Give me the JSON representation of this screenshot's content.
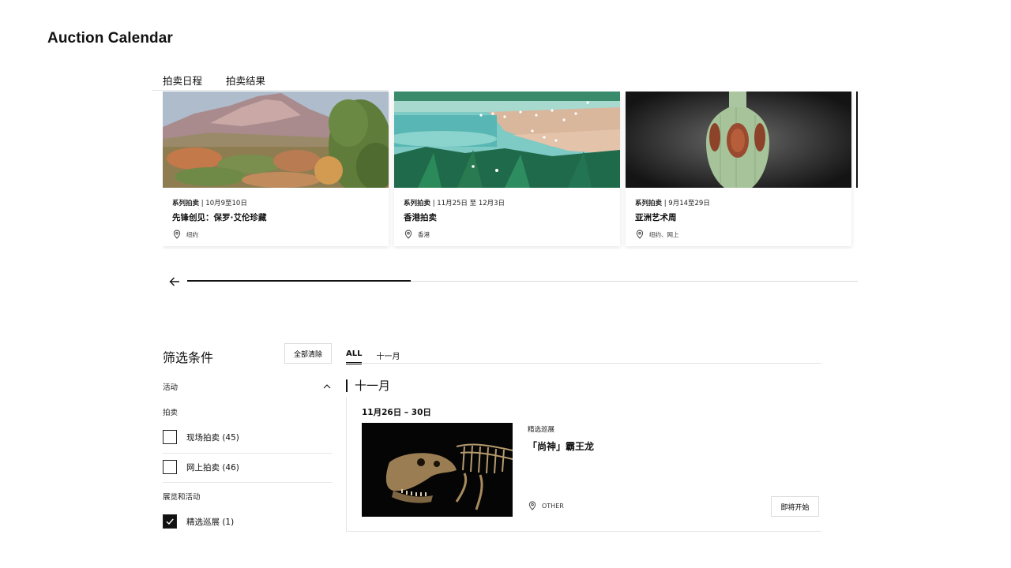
{
  "page": {
    "title": "Auction Calendar"
  },
  "tabs": [
    {
      "label": "拍卖日程",
      "active": true
    },
    {
      "label": "拍卖结果",
      "active": false
    }
  ],
  "carousel": {
    "cards": [
      {
        "meta_type": "系列拍卖",
        "meta_dates": " | 10月9至10日",
        "title": "先锋创见：保罗·艾伦珍藏",
        "location": "纽约",
        "image": "mountain-landscape-painting"
      },
      {
        "meta_type": "系列拍卖",
        "meta_dates": " | 11月25日 至 12月3日",
        "title": "香港拍卖",
        "location": "香港",
        "image": "lake-with-birds-painting"
      },
      {
        "meta_type": "系列拍卖",
        "meta_dates": " | 9月14至29日",
        "title": "亚洲艺术周",
        "location": "纽约、网上",
        "image": "celadon-vase-photo"
      }
    ],
    "progress_fraction": 0.333
  },
  "filters": {
    "title": "筛选条件",
    "clear_label": "全部清除",
    "section_label": "活动",
    "auction_group_label": "拍卖",
    "auction_options": [
      {
        "label": "现场拍卖 (45)",
        "checked": false
      },
      {
        "label": "网上拍卖 (46)",
        "checked": false
      }
    ],
    "exhibit_group_label": "展览和活动",
    "exhibit_options": [
      {
        "label": "精选巡展 (1)",
        "checked": true
      }
    ]
  },
  "month_tabs": [
    {
      "label": "ALL",
      "active": true
    },
    {
      "label": "十一月",
      "active": false
    }
  ],
  "listing": {
    "month_heading": "十一月",
    "event": {
      "date": "11月26日 – 30日",
      "type": "精选巡展",
      "title": "「尚神」霸王龙",
      "location": "OTHER",
      "button_label": "即将开始",
      "image": "t-rex-skeleton-photo"
    }
  },
  "icons": {
    "location": "map-pin-icon",
    "back": "arrow-left-icon",
    "collapse": "chevron-up-icon",
    "check": "checkmark-icon"
  },
  "colors": {
    "text": "#111111",
    "border": "#dcdcdc",
    "divider": "#e4e4e4"
  }
}
